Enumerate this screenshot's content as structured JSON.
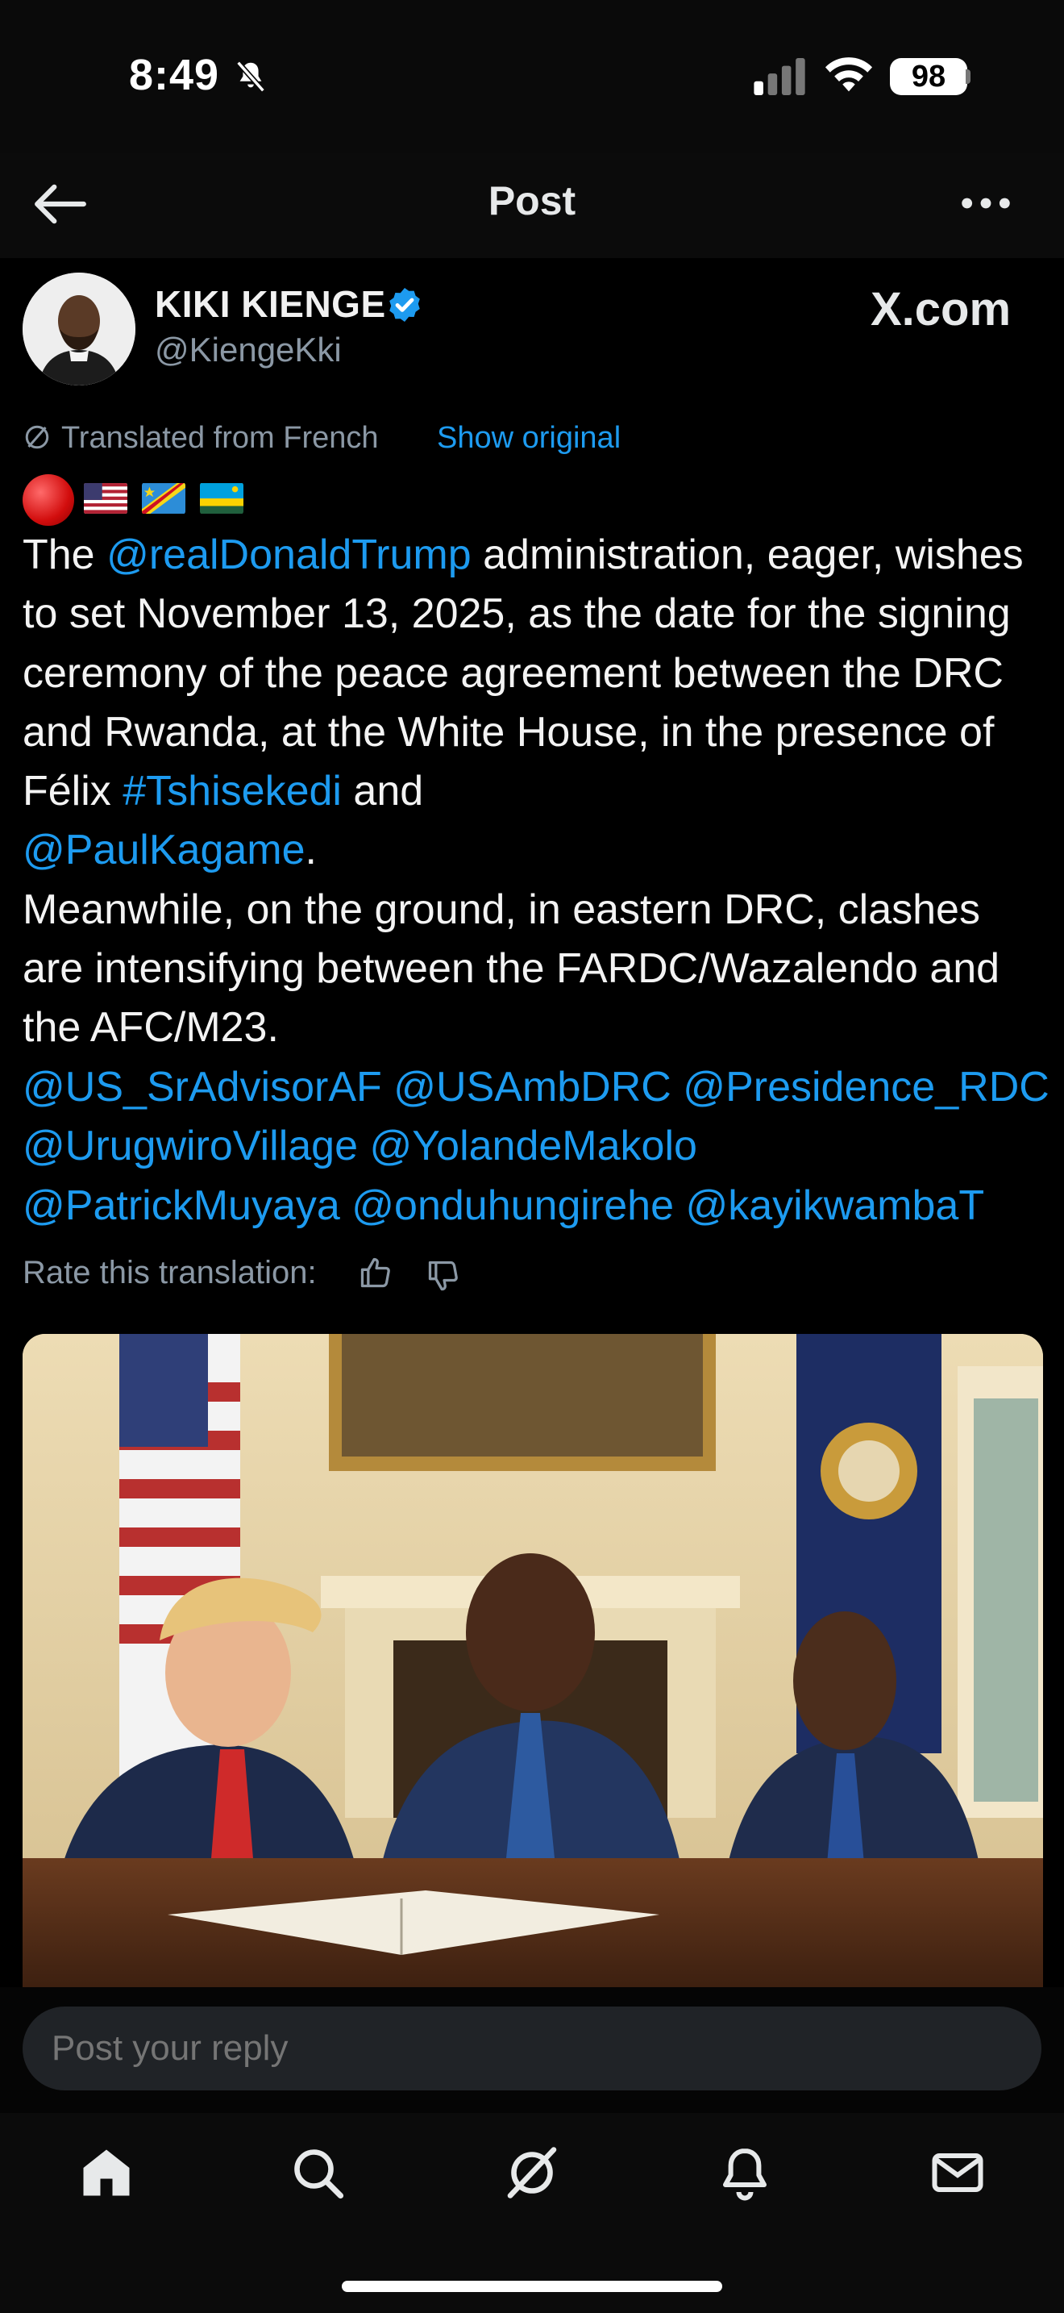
{
  "status_bar": {
    "time": "8:49",
    "battery": "98"
  },
  "header": {
    "title": "Post"
  },
  "author": {
    "name": "KIKI KIENGE",
    "handle": "@KiengeKki",
    "watermark": "X.com"
  },
  "translation": {
    "label": "Translated from French",
    "show_original": "Show original",
    "rate_label": "Rate this translation:"
  },
  "post": {
    "emoji_flags": [
      "red-circle",
      "flag-us",
      "flag-drc",
      "flag-rwanda"
    ],
    "p1_a": "The ",
    "mention_trump": "@realDonaldTrump",
    "p1_b": " administration, eager, wishes to set November 13, 2025, as the date for the signing ceremony of the peace agreement between the DRC and Rwanda, at the White House, in the presence of Félix ",
    "hashtag_tshisekedi": "#Tshisekedi",
    "p1_c": " and ",
    "mention_kagame": "@PaulKagame",
    "p1_d": ".",
    "p2": "Meanwhile, on the ground, in eastern DRC, clashes are intensifying between the FARDC/Wazalendo and the AFC/M23.",
    "mentions_line1": "@US_SrAdvisorAF @USAmbDRC @Presidence_RDC",
    "mentions_line2": "@UrugwiroVillage @YolandeMakolo",
    "mentions_line3": "@PatrickMuyaya @onduhungirehe @kayikwambaT"
  },
  "reply": {
    "placeholder": "Post your reply"
  },
  "tabs": [
    "home-icon",
    "search-icon",
    "grok-icon",
    "notifications-icon",
    "messages-icon"
  ],
  "colors": {
    "accent": "#1d9bf0",
    "background": "#000000",
    "muted": "#8b98a5"
  }
}
